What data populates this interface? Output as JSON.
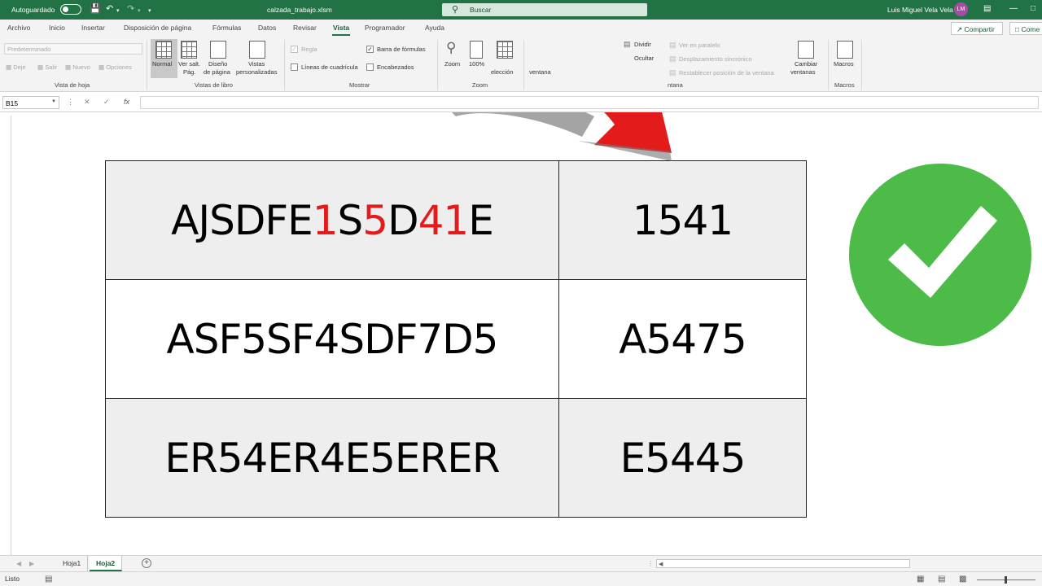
{
  "titlebar": {
    "autosave_label": "Autoguardado",
    "filename": "calzada_trabajo.xlsm",
    "search_placeholder": "Buscar",
    "user_name": "Luis Miguel Vela Vela",
    "user_initials": "LM"
  },
  "tabs": [
    "Archivo",
    "Inicio",
    "Insertar",
    "Disposición de página",
    "Fórmulas",
    "Datos",
    "Revisar",
    "Vista",
    "Programador",
    "Ayuda"
  ],
  "active_tab": "Vista",
  "share_label": "Compartir",
  "comments_label": "Come",
  "ribbon": {
    "sheet_view": {
      "select_value": "Predeterminado",
      "keep": "Deje",
      "exit": "Salir",
      "new": "Nuevo",
      "options": "Opciones",
      "group_label": "Vista de hoja"
    },
    "workbook_views": {
      "normal": "Normal",
      "page_break_1": "Ver salt.",
      "page_break_2": "Pág.",
      "page_layout_1": "Diseño",
      "page_layout_2": "de página",
      "custom_1": "Vistas",
      "custom_2": "personalizadas",
      "group_label": "Vistas de libro"
    },
    "show": {
      "ruler": "Regla",
      "formula_bar": "Barra de fórmulas",
      "gridlines": "Líneas de cuadrícula",
      "headings": "Encabezados",
      "group_label": "Mostrar"
    },
    "zoom": {
      "zoom": "Zoom",
      "hundred": "100%",
      "selection": "elección",
      "group_label": "Zoom"
    },
    "window": {
      "new_window": "ventana",
      "split": "Dividir",
      "hide": "Ocultar",
      "side_by_side": "Ver en paralelo",
      "sync_scroll": "Desplazamiento sincrónico",
      "reset_pos": "Restablecer posición de la ventana",
      "switch_1": "Cambiar",
      "switch_2": "ventanas",
      "group_label": "ntana"
    },
    "macros": {
      "label": "Macros",
      "group_label": "Macros"
    }
  },
  "formula_bar": {
    "name_box": "B15",
    "fx": "fx"
  },
  "table": {
    "rows": [
      {
        "code_parts": [
          {
            "text": "AJSDFE",
            "red": false
          },
          {
            "text": "1",
            "red": true
          },
          {
            "text": "S",
            "red": false
          },
          {
            "text": "5",
            "red": true
          },
          {
            "text": "D",
            "red": false
          },
          {
            "text": "41",
            "red": true
          },
          {
            "text": "E",
            "red": false
          }
        ],
        "result": "1541",
        "shaded": true
      },
      {
        "code": "ASF5SF4SDF7D5",
        "result": "A5475",
        "shaded": false
      },
      {
        "code": "ER54ER4E5ERER",
        "result": "E5445",
        "shaded": true
      }
    ]
  },
  "sheet_tabs": [
    "Hoja1",
    "Hoja2"
  ],
  "active_sheet": "Hoja2",
  "status": "Listo",
  "colors": {
    "excel_green": "#217346",
    "highlight_red": "#e31b1b",
    "check_green": "#4cbb47"
  }
}
